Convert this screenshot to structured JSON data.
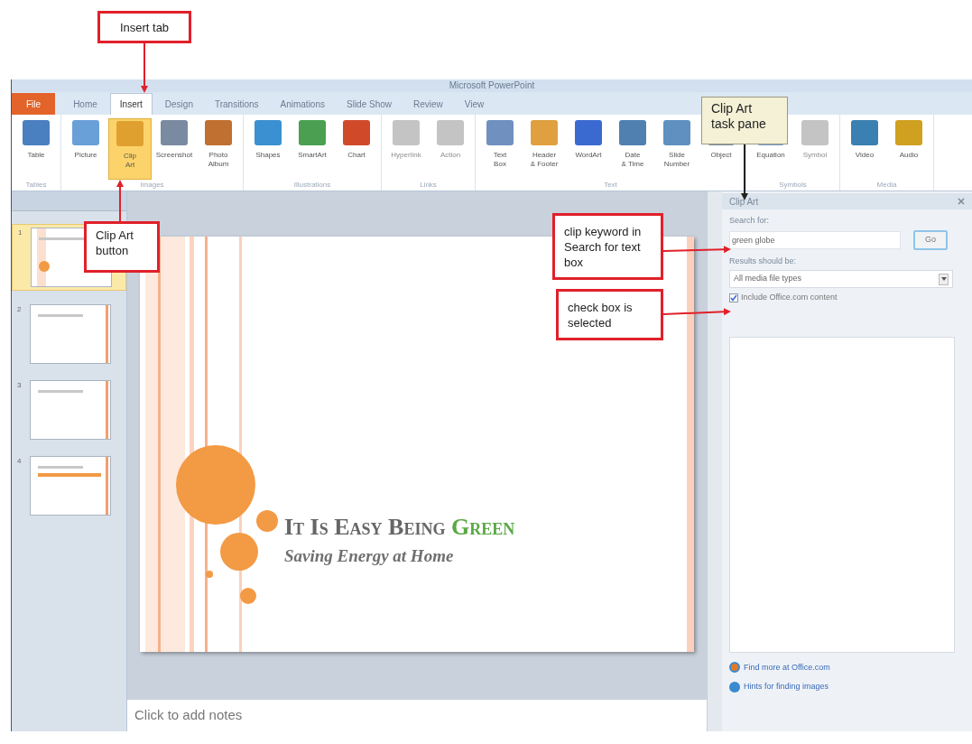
{
  "window": {
    "title": "Microsoft PowerPoint"
  },
  "tabs": [
    {
      "label": "File",
      "kind": "file",
      "selected": false
    },
    {
      "label": "Home",
      "kind": "tab",
      "selected": false
    },
    {
      "label": "Insert",
      "kind": "tab",
      "selected": true
    },
    {
      "label": "Design",
      "kind": "tab",
      "selected": false
    },
    {
      "label": "Transitions",
      "kind": "tab",
      "selected": false
    },
    {
      "label": "Animations",
      "kind": "tab",
      "selected": false
    },
    {
      "label": "Slide Show",
      "kind": "tab",
      "selected": false
    },
    {
      "label": "Review",
      "kind": "tab",
      "selected": false
    },
    {
      "label": "View",
      "kind": "tab",
      "selected": false
    }
  ],
  "ribbon_groups": [
    {
      "name": "Tables",
      "buttons": [
        {
          "label": "Table",
          "selected": false,
          "disabled": false
        }
      ]
    },
    {
      "name": "Images",
      "buttons": [
        {
          "label": "Picture",
          "selected": false,
          "disabled": false
        },
        {
          "label": "Clip\nArt",
          "selected": true,
          "disabled": false
        },
        {
          "label": "Screenshot",
          "selected": false,
          "disabled": false
        },
        {
          "label": "Photo\nAlbum",
          "selected": false,
          "disabled": false
        }
      ]
    },
    {
      "name": "Illustrations",
      "buttons": [
        {
          "label": "Shapes",
          "selected": false,
          "disabled": false
        },
        {
          "label": "SmartArt",
          "selected": false,
          "disabled": false
        },
        {
          "label": "Chart",
          "selected": false,
          "disabled": false
        }
      ]
    },
    {
      "name": "Links",
      "buttons": [
        {
          "label": "Hyperlink",
          "selected": false,
          "disabled": true
        },
        {
          "label": "Action",
          "selected": false,
          "disabled": true
        }
      ]
    },
    {
      "name": "Text",
      "buttons": [
        {
          "label": "Text\nBox",
          "selected": false,
          "disabled": false
        },
        {
          "label": "Header\n& Footer",
          "selected": false,
          "disabled": false
        },
        {
          "label": "WordArt",
          "selected": false,
          "disabled": false
        },
        {
          "label": "Date\n& Time",
          "selected": false,
          "disabled": false
        },
        {
          "label": "Slide\nNumber",
          "selected": false,
          "disabled": false
        },
        {
          "label": "Object",
          "selected": false,
          "disabled": false
        }
      ]
    },
    {
      "name": "Symbols",
      "buttons": [
        {
          "label": "Equation",
          "selected": false,
          "disabled": false
        },
        {
          "label": "Symbol",
          "selected": false,
          "disabled": true
        }
      ]
    },
    {
      "name": "Media",
      "buttons": [
        {
          "label": "Video",
          "selected": false,
          "disabled": false
        },
        {
          "label": "Audio",
          "selected": false,
          "disabled": false
        }
      ]
    }
  ],
  "slides_panel": {
    "slides": [
      {
        "number": "1",
        "selected": true
      },
      {
        "number": "2",
        "selected": false
      },
      {
        "number": "3",
        "selected": false
      },
      {
        "number": "4",
        "selected": false
      }
    ]
  },
  "slide": {
    "title": [
      {
        "text": "It Is Easy Being ",
        "color": "#666666"
      },
      {
        "text": "Green",
        "color": "#5aa845"
      }
    ],
    "subtitle": "Saving Energy at Home"
  },
  "notes": {
    "placeholder": "Click to add notes"
  },
  "task_pane": {
    "title": "Clip Art",
    "search_label": "Search for:",
    "search_value": "green globe",
    "go_button": "Go",
    "results_label": "Results should be:",
    "results_value": "All media file types",
    "include_office": {
      "label": "Include Office.com content",
      "checked": true
    },
    "links": [
      "Find more at Office.com",
      "Hints for finding images"
    ]
  },
  "callouts": [
    {
      "text": "Insert tab",
      "kind": "red"
    },
    {
      "text": "Clip Art button",
      "kind": "red"
    },
    {
      "text": "Clip Art task pane",
      "kind": "note"
    },
    {
      "text": "clip keyword in Search for text box",
      "kind": "red"
    },
    {
      "text": "check box is selected",
      "kind": "red"
    }
  ]
}
